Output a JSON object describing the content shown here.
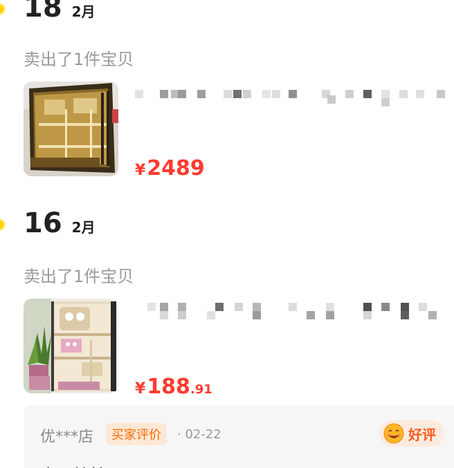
{
  "entries": [
    {
      "day": "18",
      "month": "2月",
      "sold_text": "卖出了1件宝贝",
      "price": {
        "currency": "¥",
        "integer": "2489",
        "decimal": ""
      }
    },
    {
      "day": "16",
      "month": "2月",
      "sold_text": "卖出了1件宝贝",
      "price": {
        "currency": "¥",
        "integer": "188",
        "decimal": ".91"
      },
      "review": {
        "reviewer": "优***店",
        "role_badge": "买家评价",
        "date": "· 02-22",
        "rating_label": "好评",
        "text": "宝贝拾挂"
      }
    }
  ],
  "colors": {
    "accent_price": "#ff3b30",
    "timeline_dot": "#ffd400",
    "badge_orange": "#ff6a00"
  }
}
